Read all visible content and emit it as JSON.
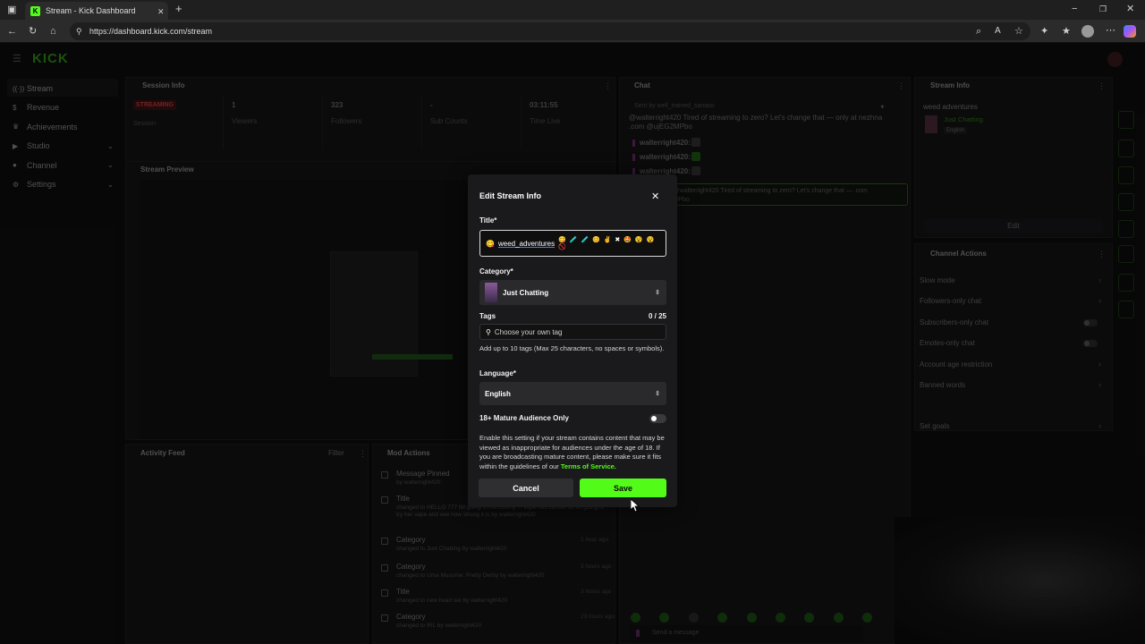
{
  "browser": {
    "tab_title": "Stream - Kick Dashboard",
    "url": "https://dashboard.kick.com/stream"
  },
  "app": {
    "logo": "KICK",
    "sidebar": [
      {
        "label": "Stream",
        "icon": "broadcast-icon",
        "chev": false
      },
      {
        "label": "Revenue",
        "icon": "dollar-icon",
        "chev": false
      },
      {
        "label": "Achievements",
        "icon": "trophy-icon",
        "chev": false
      },
      {
        "label": "Studio",
        "icon": "video-icon",
        "chev": true
      },
      {
        "label": "Channel",
        "icon": "user-icon",
        "chev": true
      },
      {
        "label": "Settings",
        "icon": "gear-icon",
        "chev": true
      }
    ]
  },
  "session": {
    "header": "Session Info",
    "status": "STREAMING",
    "status_sub": "Session",
    "stats": [
      {
        "value": "1",
        "label": "Viewers"
      },
      {
        "value": "323",
        "label": "Followers"
      },
      {
        "value": "-",
        "label": "Sub Counts"
      },
      {
        "value": "03:11:55",
        "label": "Time Live"
      }
    ]
  },
  "preview": {
    "header": "Stream Preview"
  },
  "chat": {
    "header": "Chat",
    "pinned_by": "Sent by well_trained_sanaso",
    "pinned_msg": "@walterright420 Tired of streaming to zero? Let's change that — only at nezhna .com @ujEG2MPbo",
    "users": [
      "walterright420:",
      "walterright420:",
      "walterright420:"
    ],
    "highlight": "sanaso: @walterright420 Tired of streaming to zero? Let's change that — .com @ujEG2MPbo",
    "input_placeholder": "Send a message"
  },
  "stream_info": {
    "header": "Stream Info",
    "title": "weed adventures",
    "category": "Just Chatting",
    "language": "English",
    "edit": "Edit"
  },
  "channel_actions": {
    "header": "Channel Actions",
    "items": [
      "Slow mode",
      "Followers-only chat",
      "Subscribers-only chat",
      "Emotes-only chat",
      "Account age restriction",
      "Banned words",
      "Set goals"
    ]
  },
  "activity": {
    "header": "Activity Feed",
    "filter": "Filter"
  },
  "mod_actions": {
    "header": "Mod Actions",
    "items": [
      {
        "title": "Message Pinned",
        "detail": "by walterright420",
        "time": ""
      },
      {
        "title": "Title",
        "detail": "changed to HELLO 777 IM going to the colony ... vape has cancer so im going to try her vape and see how strong it is by walterright420",
        "time": ""
      },
      {
        "title": "Category",
        "detail": "changed to Just Chatting by walterright420",
        "time": "1 hour ago"
      },
      {
        "title": "Category",
        "detail": "changed to Uma Musume: Pretty Derby by walterright420",
        "time": "3 hours ago"
      },
      {
        "title": "Title",
        "detail": "changed to new head set by walterright420",
        "time": "3 hours ago"
      },
      {
        "title": "Category",
        "detail": "changed to IRL by walterright420",
        "time": "23 hours ago"
      }
    ]
  },
  "modal": {
    "title": "Edit Stream Info",
    "title_label": "Title*",
    "title_value": "weed_adventures",
    "category_label": "Category*",
    "category_value": "Just Chatting",
    "tags_label": "Tags",
    "tags_count": "0 / 25",
    "tags_placeholder": "Choose your own tag",
    "tags_help": "Add up to 10 tags (Max 25 characters, no spaces or symbols).",
    "language_label": "Language*",
    "language_value": "English",
    "mature_label": "18+ Mature Audience Only",
    "mature_on": false,
    "mature_help": "Enable this setting if your stream contains content that may be viewed as inappropriate for audiences under the age of 18. If you are broadcasting mature content, please make sure it fits within the guidelines of our",
    "tos": "Terms of Service.",
    "cancel": "Cancel",
    "save": "Save"
  },
  "colors": {
    "accent": "#53fc18",
    "bg": "#0d0d0e",
    "modal": "#1a1a1c"
  }
}
